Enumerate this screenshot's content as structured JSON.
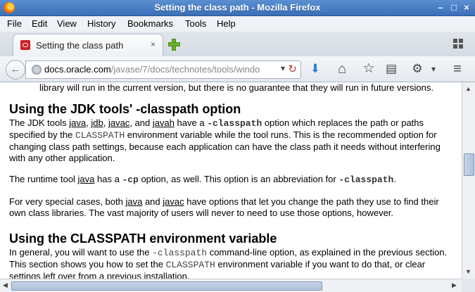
{
  "window": {
    "title": "Setting the class path - Mozilla Firefox",
    "controls": {
      "minimize": "–",
      "maximize": "□",
      "close": "×"
    }
  },
  "menubar": {
    "items": [
      "File",
      "Edit",
      "View",
      "History",
      "Bookmarks",
      "Tools",
      "Help"
    ]
  },
  "tabs": [
    {
      "title": "Setting the class path",
      "close": "×",
      "icon": "oracle-favicon"
    }
  ],
  "navbar": {
    "back": "←",
    "url_domain": "docs.oracle.com",
    "url_path": "/javase/7/docs/technotes/tools/windo",
    "dropdown": "▾",
    "reload": "↻"
  },
  "toolbar_icons": {
    "download": "⬇",
    "home": "⌂",
    "bookmark_star": "☆",
    "reader": "▤",
    "addon": "⚙",
    "addon_dropdown": "▾",
    "menu": "≡"
  },
  "content": {
    "intro_tail": "library will run in the current version, but there is no guarantee that they will run in future versions.",
    "h_jdk": "Using the JDK tools' -classpath option",
    "p1": {
      "a": "The JDK tools ",
      "java": "java",
      "c1": ", ",
      "jdb": "jdb",
      "c2": ", ",
      "javac": "javac",
      "c3": ", and ",
      "javah": "javah",
      "b": " have a ",
      "opt": "-classpath",
      "c": " option which replaces the path or paths specified by the ",
      "env": "CLASSPATH",
      "d": " environment variable while the tool runs. This is the recommended option for changing class path settings, because each application can have the class path it needs without interfering with any other application."
    },
    "p2": {
      "a": "The runtime tool ",
      "java": "java",
      "b": " has a ",
      "cp": "-cp",
      "c": " option, as well. This option is an abbreviation for ",
      "opt": "-classpath",
      "d": "."
    },
    "p3": {
      "a": "For very special cases, both ",
      "java": "java",
      "b": " and ",
      "javac": "javac",
      "c": " have options that let you change the path they use to find their own class libraries. The vast majority of users will never to need to use those options, however."
    },
    "h_env": "Using the CLASSPATH environment variable",
    "p4": {
      "a": "In general, you will want to use the ",
      "opt": "-classpath",
      "b": " command-line option, as explained in the previous section. This section shows you how to set the ",
      "env": "CLASSPATH",
      "c": " environment variable if you want to do that, or clear settings left over from a previous installation."
    }
  },
  "scrollbars": {
    "up": "▲",
    "down": "▼",
    "left": "◀",
    "right": "▶"
  }
}
